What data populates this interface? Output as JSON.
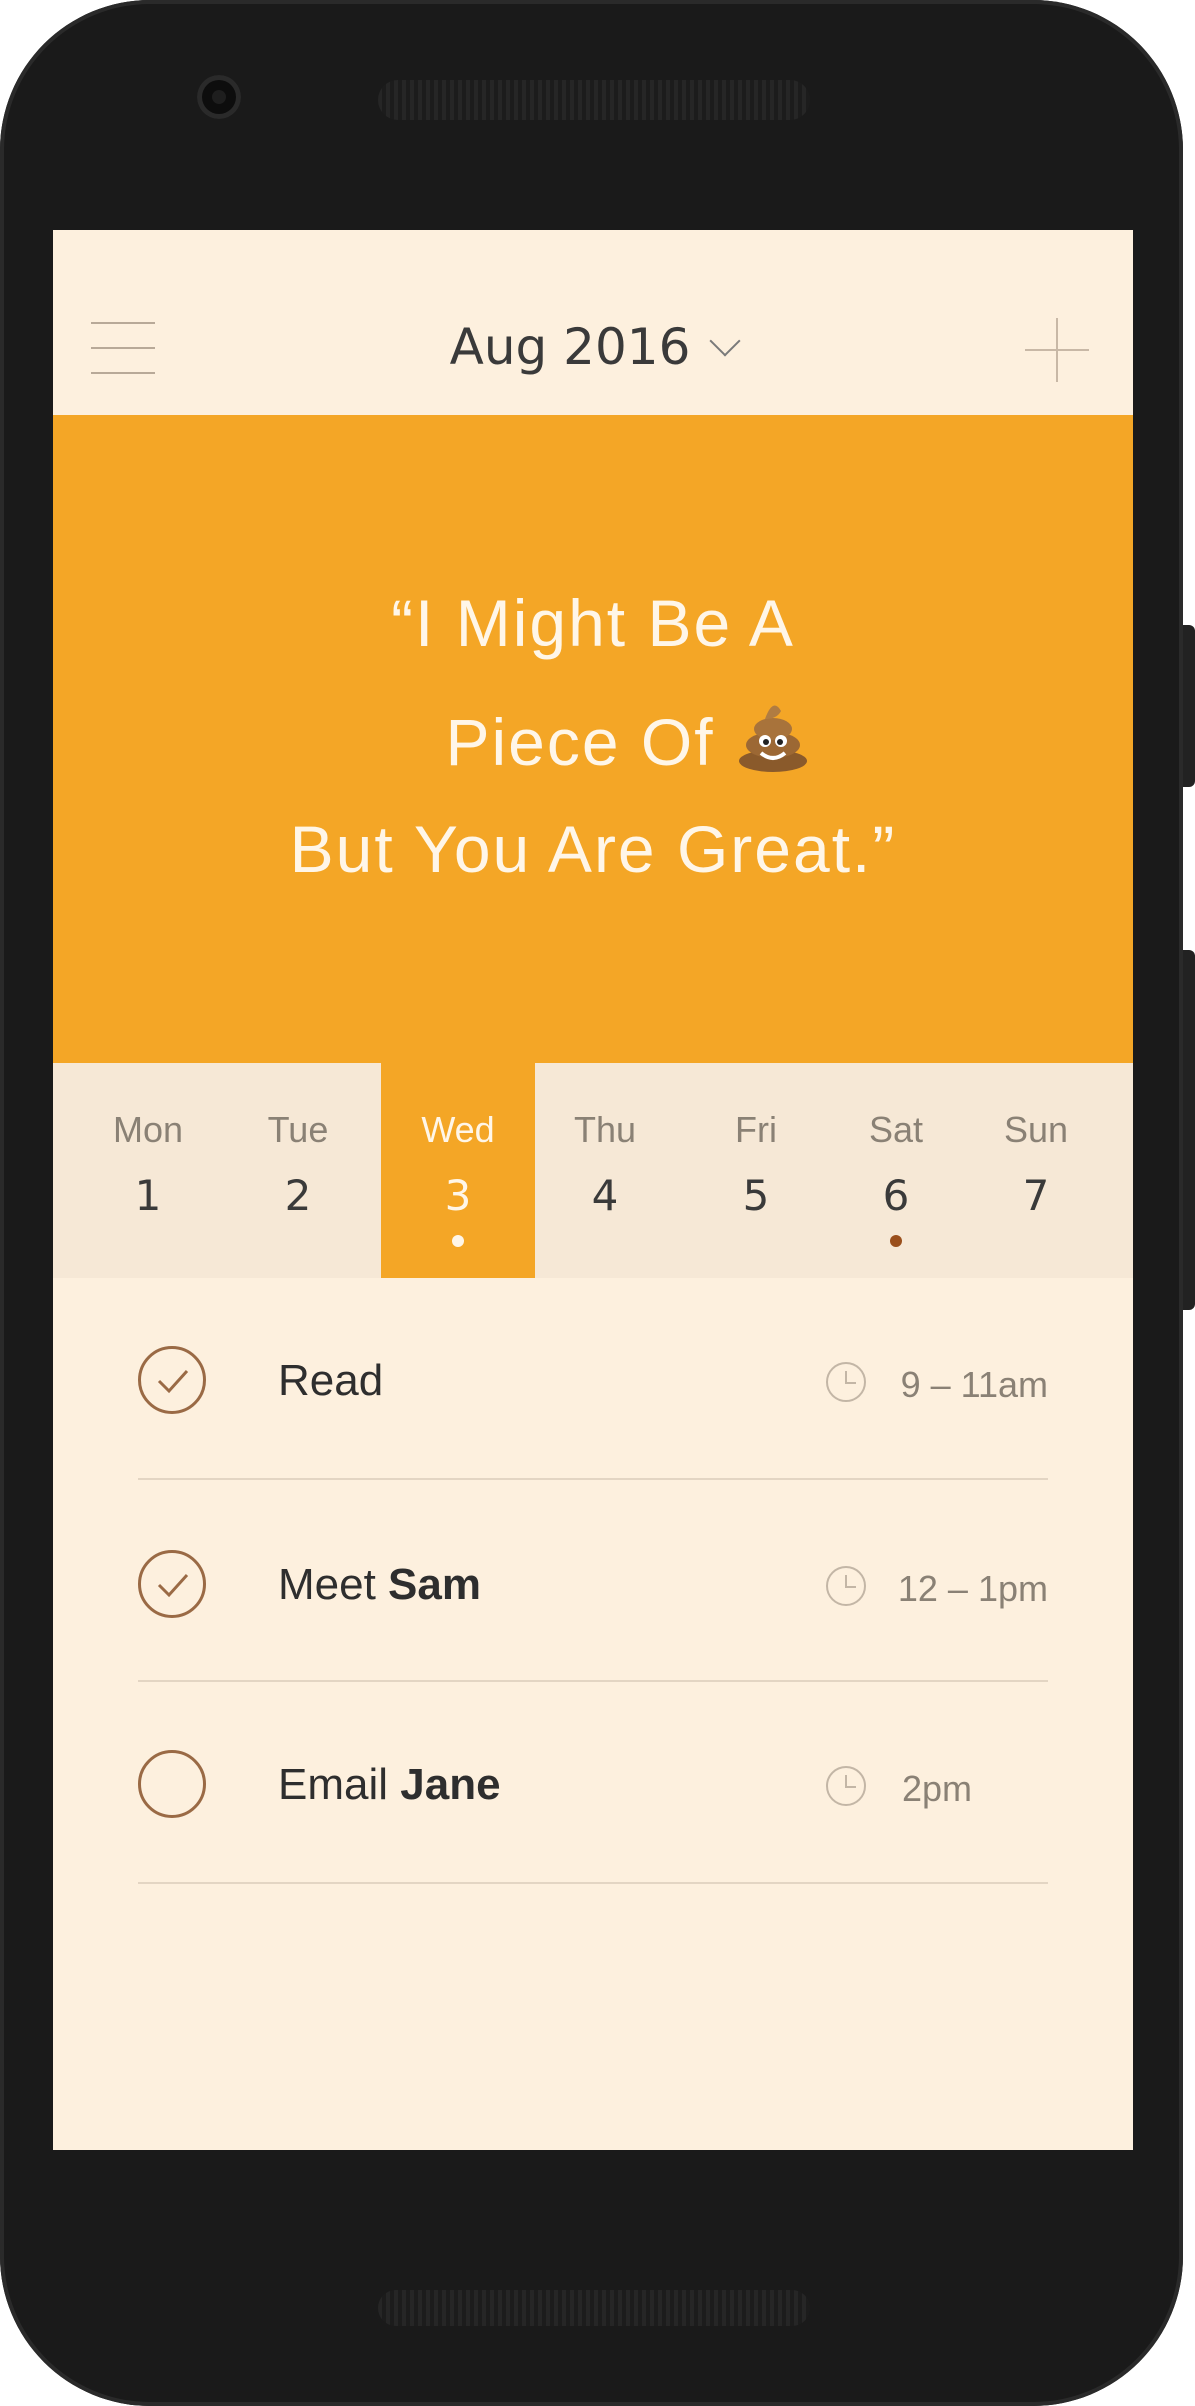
{
  "header": {
    "month_label": "Aug 2016",
    "menu_icon": "hamburger-menu-icon",
    "add_icon": "plus-icon"
  },
  "banner": {
    "quote_line1": "“I Might Be A",
    "quote_line2": "Piece Of",
    "quote_emoji": "pile-of-poo-emoji",
    "quote_line3": "But You Are Great.”",
    "color": "#f4a626"
  },
  "week": {
    "days": [
      {
        "name": "Mon",
        "num": "1"
      },
      {
        "name": "Tue",
        "num": "2"
      },
      {
        "name": "Wed",
        "num": "3"
      },
      {
        "name": "Thu",
        "num": "4"
      },
      {
        "name": "Fri",
        "num": "5"
      },
      {
        "name": "Sat",
        "num": "6"
      },
      {
        "name": "Sun",
        "num": "7"
      }
    ],
    "selected_day": "Wed"
  },
  "tasks": [
    {
      "prefix": "Read",
      "bold": "",
      "time": "9 – 11am",
      "done": true
    },
    {
      "prefix": "Meet ",
      "bold": "Sam",
      "time": "12 – 1pm",
      "done": true
    },
    {
      "prefix": "Email ",
      "bold": "Jane",
      "time": "2pm",
      "done": false
    }
  ],
  "colors": {
    "accent": "#f4a626",
    "background": "#fdf0de",
    "check": "#9a6a45",
    "event_dot": "#9a4f1c"
  }
}
